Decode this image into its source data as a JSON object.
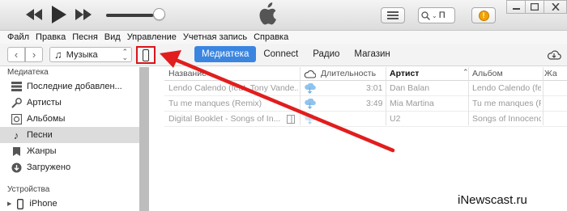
{
  "menu": [
    "Файл",
    "Правка",
    "Песня",
    "Вид",
    "Управление",
    "Учетная запись",
    "Справка"
  ],
  "playback": {
    "volume_fraction": 0.85
  },
  "search": {
    "value": "П"
  },
  "toolbar": {
    "media_type": "Музыка",
    "tabs": [
      {
        "label": "Медиатека",
        "active": true
      },
      {
        "label": "Connect",
        "active": false
      },
      {
        "label": "Радио",
        "active": false
      },
      {
        "label": "Магазин",
        "active": false
      }
    ]
  },
  "sidebar": {
    "library_header": "Медиатека",
    "items": [
      {
        "label": "Последние добавлен...",
        "icon": "recently-added-icon"
      },
      {
        "label": "Артисты",
        "icon": "artist-icon"
      },
      {
        "label": "Альбомы",
        "icon": "album-icon"
      },
      {
        "label": "Песни",
        "icon": "music-note-icon",
        "selected": true
      },
      {
        "label": "Жанры",
        "icon": "genre-icon"
      },
      {
        "label": "Загружено",
        "icon": "download-icon"
      }
    ],
    "devices_header": "Устройства",
    "devices": [
      {
        "label": "iPhone",
        "icon": "iphone-icon"
      }
    ]
  },
  "table": {
    "columns": [
      "Название",
      "Длительность",
      "Артист",
      "Альбом",
      "Жа"
    ],
    "rows": [
      {
        "title": "Lendo Calendo (feat. Tony Vande...",
        "duration": "3:01",
        "artist": "Dan Balan",
        "album": "Lendo Calendo (feat..."
      },
      {
        "title": "Tu me manques (Remix)",
        "duration": "3:49",
        "artist": "Mia Martina",
        "album": "Tu me manques (Remi..."
      },
      {
        "title": "Digital Booklet - Songs of In...",
        "duration": "",
        "artist": "U2",
        "album": "Songs of Innocence"
      }
    ]
  },
  "colors": {
    "accent": "#3a85e0",
    "highlight": "#d9161b",
    "alert": "#f2a100"
  },
  "watermark": "iNewscast.ru"
}
